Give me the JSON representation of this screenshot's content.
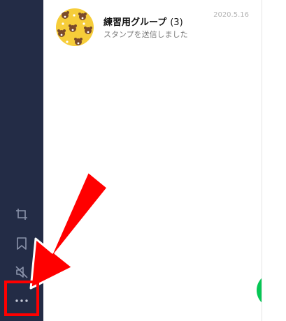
{
  "colors": {
    "sidebar": "#232c46",
    "accent_green": "#06c755",
    "annotation_red": "#ff0000"
  },
  "sidebar": {
    "icons": [
      "crop-icon",
      "bookmark-icon",
      "mute-icon",
      "more-icon"
    ]
  },
  "chats": [
    {
      "title": "練習用グループ",
      "count": "(3)",
      "subtitle": "スタンプを送信しました",
      "date": "2020.5.16",
      "avatar_icon": "bear-pattern-avatar"
    }
  ],
  "fab": {
    "icon": "new-chat-icon"
  },
  "annotation": {
    "arrow": "red-arrow",
    "highlight": "red-box-highlight"
  }
}
